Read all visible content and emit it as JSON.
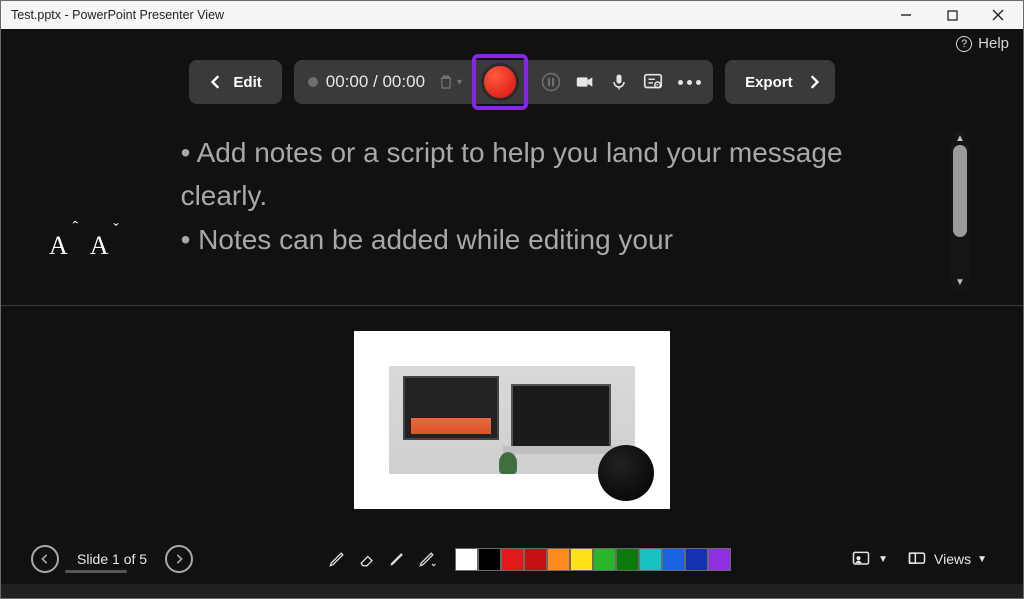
{
  "window": {
    "title": "Test.pptx - PowerPoint Presenter View"
  },
  "help": {
    "label": "Help"
  },
  "toolbar": {
    "edit_label": "Edit",
    "timer": "00:00 / 00:00",
    "export_label": "Export"
  },
  "notes": {
    "line1": "• Add notes or a script to help you land your message clearly.",
    "line2": "• Notes can be added while editing your"
  },
  "footer": {
    "slide_counter": "Slide 1 of 5",
    "views_label": "Views"
  },
  "swatches": [
    "#ffffff",
    "#000000",
    "#e11919",
    "#c41111",
    "#ff8a1e",
    "#ffe11a",
    "#2bb52b",
    "#0a7a0a",
    "#16c2c2",
    "#1a64e1",
    "#1530b0",
    "#8f2fe0"
  ]
}
